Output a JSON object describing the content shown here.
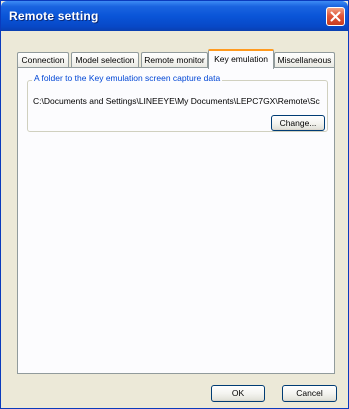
{
  "window": {
    "title": "Remote setting"
  },
  "tabs": [
    {
      "label": "Connection",
      "active": false
    },
    {
      "label": "Model selection",
      "active": false
    },
    {
      "label": "Remote monitor",
      "active": false
    },
    {
      "label": "Key emulation",
      "active": true
    },
    {
      "label": "Miscellaneous",
      "active": false
    }
  ],
  "group": {
    "label": "A folder to the Key emulation screen capture data",
    "path": "C:\\Documents and Settings\\LINEEYE\\My Documents\\LEPC7GX\\Remote\\Sc",
    "change_label": "Change..."
  },
  "buttons": {
    "ok": "OK",
    "cancel": "Cancel"
  },
  "colors": {
    "titlebar": "#0a55d8",
    "active_tab_accent": "#ff9a1f",
    "group_label": "#0046d5"
  }
}
